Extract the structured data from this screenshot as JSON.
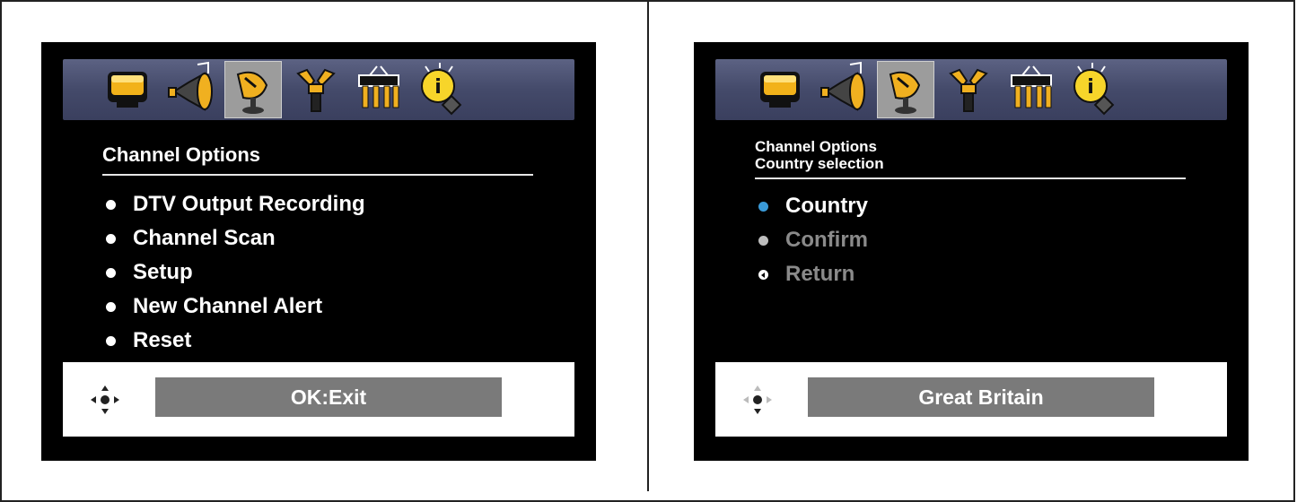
{
  "left_screen": {
    "title": "Channel Options",
    "menu_items": [
      {
        "label": "DTV Output Recording"
      },
      {
        "label": "Channel Scan"
      },
      {
        "label": "Setup"
      },
      {
        "label": "New Channel Alert"
      },
      {
        "label": "Reset"
      }
    ],
    "status": "OK:Exit"
  },
  "right_screen": {
    "title": "Channel Options",
    "subtitle": "Country selection",
    "menu_items": [
      {
        "label": "Country",
        "state": "active"
      },
      {
        "label": "Confirm",
        "state": "disabled"
      },
      {
        "label": "Return",
        "state": "disabled"
      }
    ],
    "status": "Great Britain"
  },
  "icon_bar": {
    "icons": [
      "picture-icon",
      "sound-icon",
      "channel-icon",
      "setup-icon",
      "connections-icon",
      "info-icon"
    ],
    "selected": "channel-icon"
  },
  "colors": {
    "screen_bg": "#000000",
    "icon_bar": "#4b5172",
    "highlight": "#9c9c9c",
    "active_bullet": "#3a9ad8",
    "status_box": "#7a7a7a"
  }
}
